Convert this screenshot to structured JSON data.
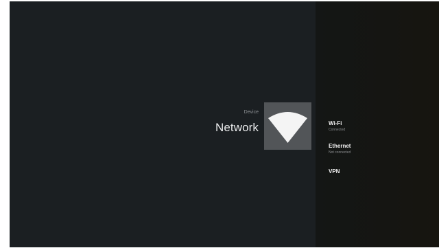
{
  "header": {
    "breadcrumb": "Device",
    "title": "Network"
  },
  "icon": {
    "name": "wifi-icon",
    "tile_color": "#525558"
  },
  "menu": {
    "items": [
      {
        "label": "Wi-Fi",
        "status": "Connected"
      },
      {
        "label": "Ethernet",
        "status": "Not connected"
      },
      {
        "label": "VPN",
        "status": ""
      }
    ]
  },
  "colors": {
    "background": "#1b1f22",
    "side_panel": "#151512",
    "text_primary": "#e9eaeb",
    "text_secondary": "#8b8e90"
  }
}
